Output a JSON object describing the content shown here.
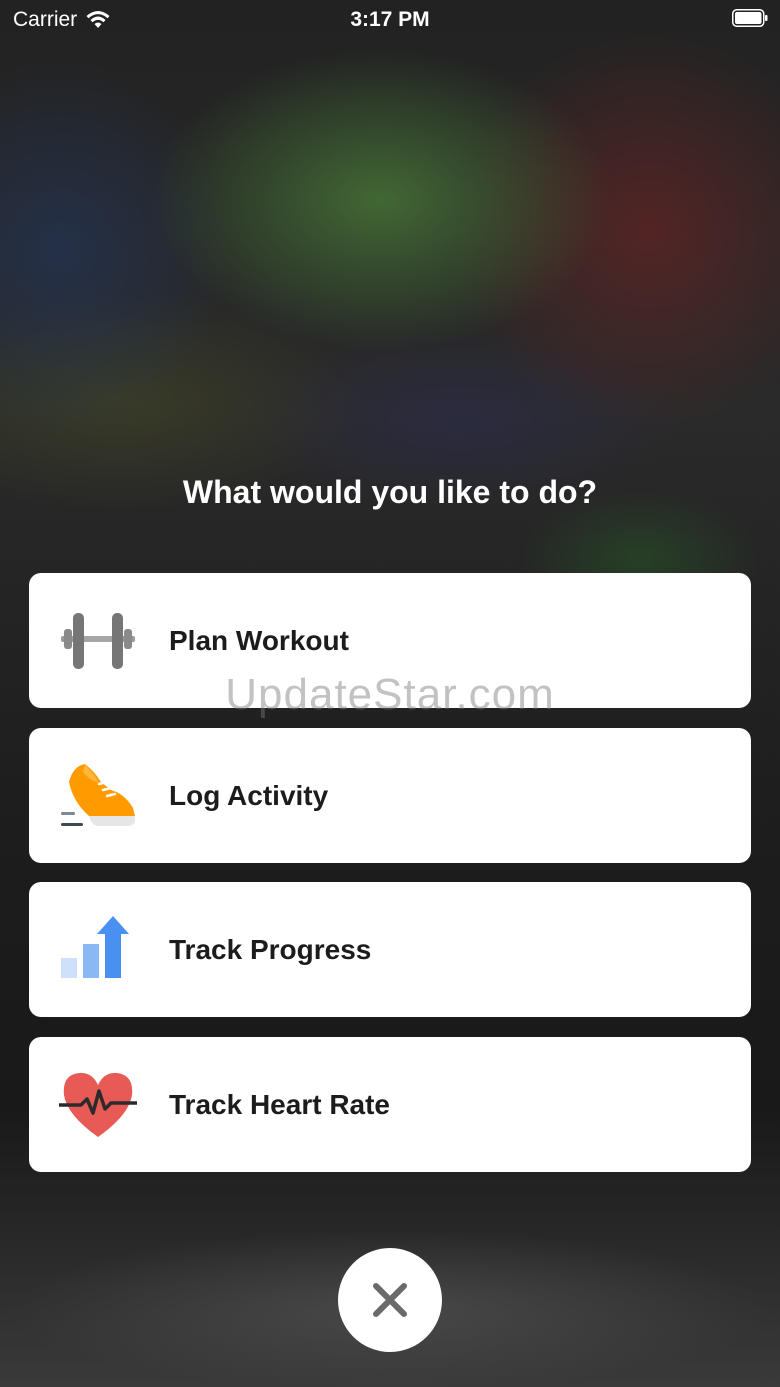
{
  "status_bar": {
    "carrier": "Carrier",
    "time": "3:17 PM"
  },
  "prompt": "What would you like to do?",
  "watermark": "UpdateStar.com",
  "actions": [
    {
      "label": "Plan Workout",
      "icon": "dumbbell-icon"
    },
    {
      "label": "Log Activity",
      "icon": "running-shoe-icon"
    },
    {
      "label": "Track Progress",
      "icon": "progress-chart-icon"
    },
    {
      "label": "Track Heart Rate",
      "icon": "heart-rate-icon"
    }
  ],
  "colors": {
    "shoe_orange": "#ff9500",
    "progress_blue": "#4a90f0",
    "heart_red": "#e85a55",
    "dumbbell_gray": "#7a7a7a"
  }
}
